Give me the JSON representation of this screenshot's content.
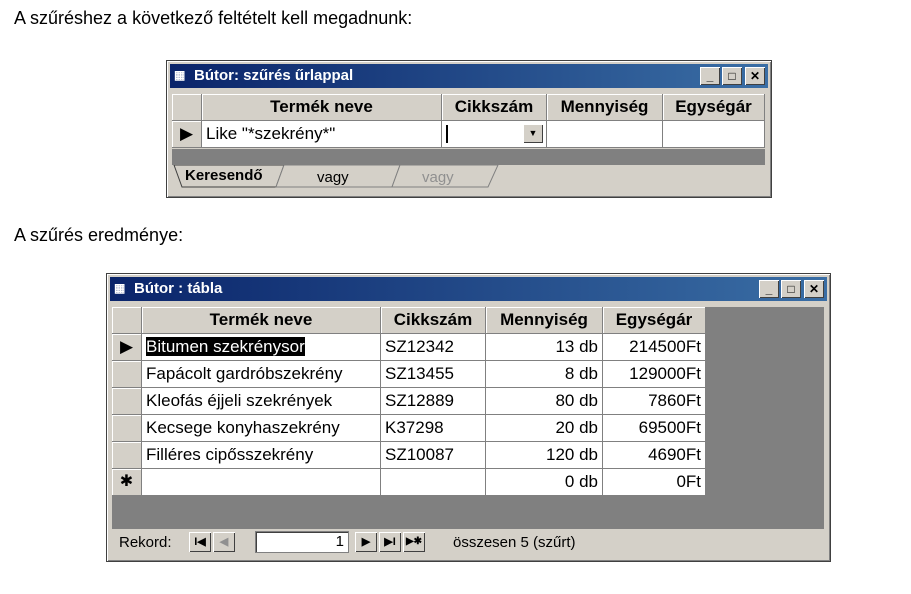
{
  "intro_text": "A szűréshez a következő feltételt kell megadnunk:",
  "result_text": "A szűrés eredménye:",
  "filter_window": {
    "title": "Bútor: szűrés űrlappal",
    "columns": [
      "Termék neve",
      "Cikkszám",
      "Mennyiség",
      "Egységár"
    ],
    "criteria_row": [
      "Like \"*szekrény*\"",
      "",
      "",
      ""
    ],
    "tabs": [
      "Keresendő",
      "vagy",
      "vagy"
    ]
  },
  "table_window": {
    "title": "Bútor : tábla",
    "columns": [
      "Termék neve",
      "Cikkszám",
      "Mennyiség",
      "Egységár"
    ],
    "rows": [
      [
        "Bitumen szekrénysor",
        "SZ12342",
        "13 db",
        "214500Ft"
      ],
      [
        "Fapácolt gardróbszekrény",
        "SZ13455",
        "8 db",
        "129000Ft"
      ],
      [
        "Kleofás éjjeli szekrények",
        "SZ12889",
        "80 db",
        "7860Ft"
      ],
      [
        "Kecsege konyhaszekrény",
        "K37298",
        "20 db",
        "69500Ft"
      ],
      [
        "Filléres cipősszekrény",
        "SZ10087",
        "120 db",
        "4690Ft"
      ]
    ],
    "new_row": [
      "",
      "",
      "0 db",
      "0Ft"
    ],
    "new_row_marker": "✱",
    "navigation": {
      "label": "Rekord:",
      "current": "1",
      "summary": "összesen 5 (szűrt)"
    }
  },
  "window_buttons": {
    "minimize": "_",
    "maximize": "□",
    "close": "✕"
  }
}
